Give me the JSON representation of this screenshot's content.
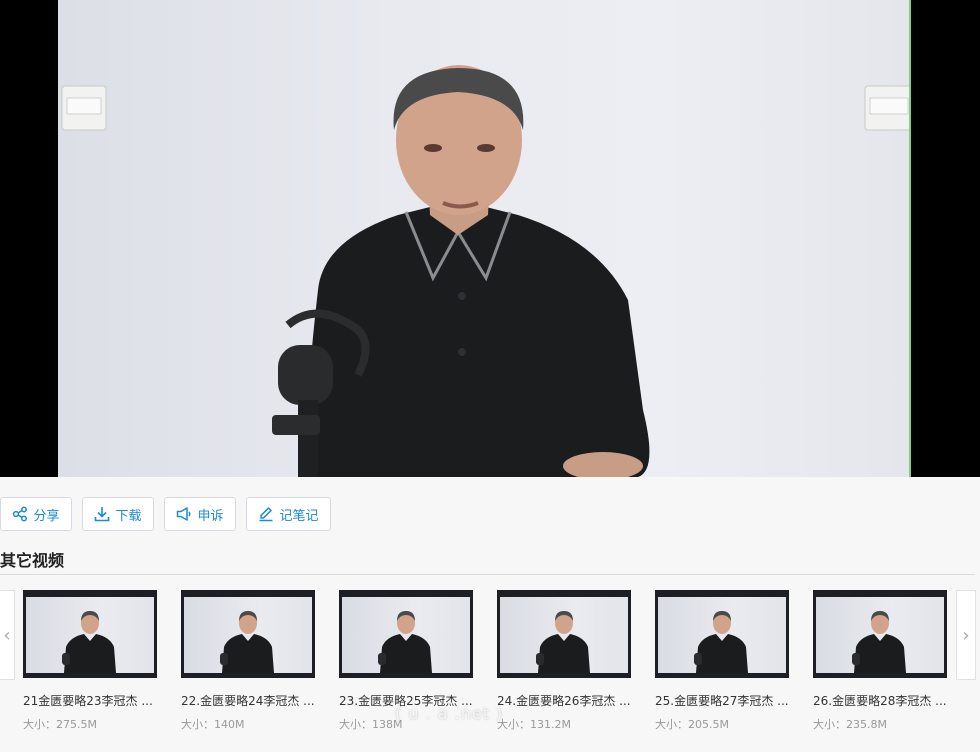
{
  "actions": {
    "share_label": "分享",
    "download_label": "下载",
    "report_label": "申诉",
    "note_label": "记笔记"
  },
  "other_videos": {
    "title": "其它视频",
    "items": [
      {
        "title": "21金匮要略23李冠杰 ...",
        "size": "大小：275.5M"
      },
      {
        "title": "22.金匮要略24李冠杰 ...",
        "size": "大小：140M"
      },
      {
        "title": "23.金匮要略25李冠杰 ...",
        "size": "大小：138M"
      },
      {
        "title": "24.金匮要略26李冠杰 ...",
        "size": "大小：131.2M"
      },
      {
        "title": "25.金匮要略27李冠杰 ...",
        "size": "大小：205.5M"
      },
      {
        "title": "26.金匮要略28李冠杰 ...",
        "size": "大小：235.8M"
      }
    ]
  },
  "watermark": "( u  .  a .net )",
  "colors": {
    "accent": "#1b8ad6"
  }
}
